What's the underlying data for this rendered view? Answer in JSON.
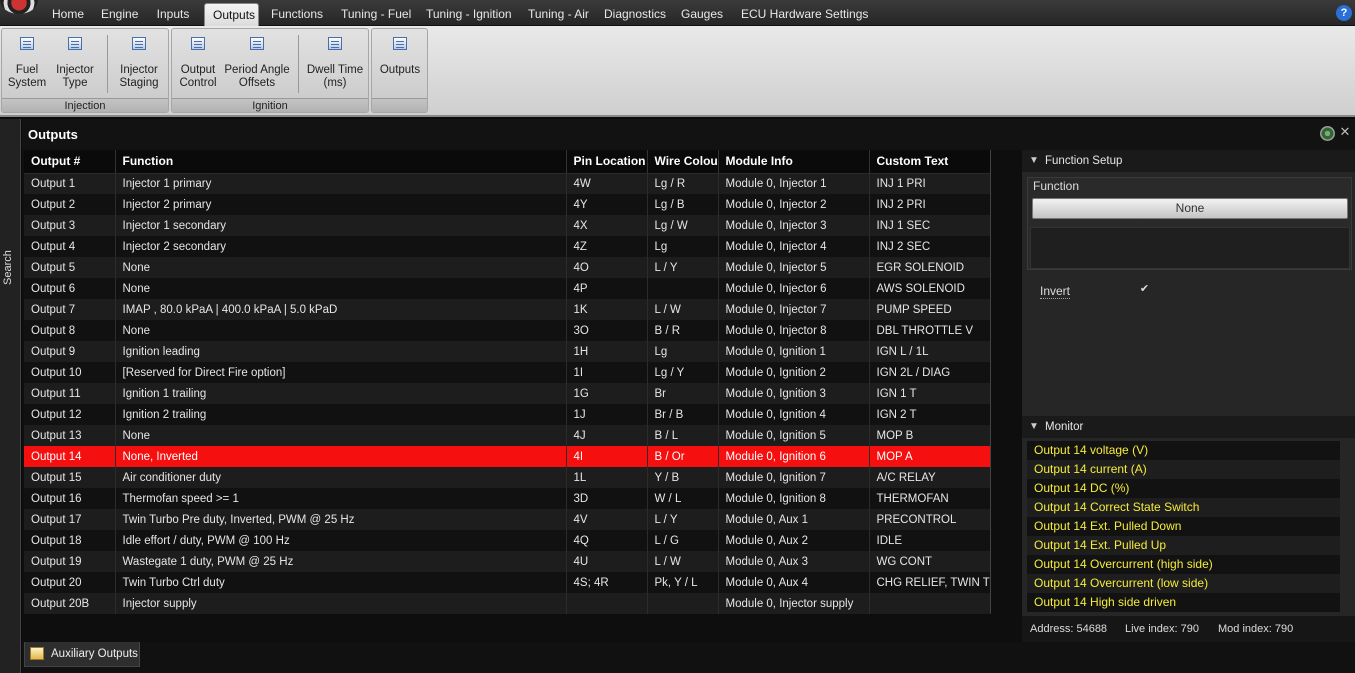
{
  "menu": {
    "tabs": [
      "Home",
      "Engine",
      "Inputs",
      "Outputs",
      "Functions",
      "Tuning - Fuel",
      "Tuning - Ignition",
      "Tuning - Air",
      "Diagnostics",
      "Gauges",
      "ECU Hardware Settings"
    ],
    "active": "Outputs",
    "help": "?"
  },
  "ribbon": {
    "groups": [
      {
        "label": "Injection",
        "buttons": [
          [
            "Fuel",
            "System"
          ],
          [
            "Injector",
            "Type"
          ],
          [
            "Injector",
            "Staging"
          ]
        ]
      },
      {
        "label": "Ignition",
        "buttons": [
          [
            "Output",
            "Control"
          ],
          [
            "Period Angle",
            "Offsets"
          ],
          [
            "Dwell Time",
            "(ms)"
          ]
        ]
      },
      {
        "label": "",
        "buttons": [
          [
            "Outputs"
          ]
        ]
      }
    ]
  },
  "sidebar": {
    "search_label": "Search"
  },
  "panel": {
    "title": "Outputs"
  },
  "table": {
    "headers": [
      "Output #",
      "Function",
      "Pin Location",
      "Wire Colour",
      "Module Info",
      "Custom Text"
    ],
    "selected_index": 13,
    "rows": [
      [
        "Output 1",
        "Injector 1 primary",
        "4W",
        "Lg / R",
        "Module 0, Injector 1",
        "INJ 1 PRI"
      ],
      [
        "Output 2",
        "Injector 2 primary",
        "4Y",
        "Lg / B",
        "Module 0, Injector 2",
        "INJ 2 PRI"
      ],
      [
        "Output 3",
        "Injector 1 secondary",
        "4X",
        "Lg / W",
        "Module 0, Injector 3",
        "INJ 1 SEC"
      ],
      [
        "Output 4",
        "Injector 2 secondary",
        "4Z",
        "Lg",
        "Module 0, Injector 4",
        "INJ 2 SEC"
      ],
      [
        "Output 5",
        "None",
        "4O",
        "L / Y",
        "Module 0, Injector 5",
        "EGR SOLENOID"
      ],
      [
        "Output 6",
        "None",
        "4P",
        "",
        "Module 0, Injector 6",
        "AWS SOLENOID"
      ],
      [
        "Output 7",
        "IMAP , 80.0 kPaA | 400.0 kPaA | 5.0 kPaD",
        "1K",
        "L / W",
        "Module 0, Injector 7",
        "PUMP SPEED"
      ],
      [
        "Output 8",
        "None",
        "3O",
        "B / R",
        "Module 0, Injector 8",
        "DBL THROTTLE V"
      ],
      [
        "Output 9",
        "Ignition leading",
        "1H",
        "Lg",
        "Module 0, Ignition 1",
        "IGN L / 1L"
      ],
      [
        "Output 10",
        "[Reserved for Direct Fire option]",
        "1I",
        "Lg / Y",
        "Module 0, Ignition 2",
        "IGN 2L / DIAG"
      ],
      [
        "Output 11",
        "Ignition 1 trailing",
        "1G",
        "Br",
        "Module 0, Ignition 3",
        "IGN 1 T"
      ],
      [
        "Output 12",
        "Ignition 2 trailing",
        "1J",
        "Br / B",
        "Module 0, Ignition 4",
        "IGN 2 T"
      ],
      [
        "Output 13",
        "None",
        "4J",
        "B / L",
        "Module 0, Ignition 5",
        "MOP B"
      ],
      [
        "Output 14",
        "None, Inverted",
        "4I",
        "B / Or",
        "Module 0, Ignition 6",
        "MOP A"
      ],
      [
        "Output 15",
        "Air conditioner duty",
        "1L",
        "Y / B",
        "Module 0, Ignition 7",
        "A/C RELAY"
      ],
      [
        "Output 16",
        "Thermofan speed >= 1",
        "3D",
        "W / L",
        "Module 0, Ignition 8",
        "THERMOFAN"
      ],
      [
        "Output 17",
        "Twin Turbo Pre duty, Inverted, PWM @ 25 Hz",
        "4V",
        "L / Y",
        "Module 0, Aux 1",
        "PRECONTROL"
      ],
      [
        "Output 18",
        "Idle effort / duty, PWM @ 100 Hz",
        "4Q",
        "L / G",
        "Module 0, Aux 2",
        "IDLE"
      ],
      [
        "Output 19",
        "Wastegate 1 duty, PWM @ 25 Hz",
        "4U",
        "L / W",
        "Module 0, Aux 3",
        "WG CONT"
      ],
      [
        "Output 20",
        "Twin Turbo Ctrl duty",
        "4S; 4R",
        "Pk, Y / L",
        "Module 0, Aux 4",
        "CHG RELIEF, TWIN TUR"
      ],
      [
        "Output 20B",
        "Injector supply",
        "",
        "",
        "Module 0, Injector supply",
        ""
      ]
    ]
  },
  "function_setup": {
    "header": "Function Setup",
    "function_label": "Function",
    "function_value": "None",
    "invert_label": "Invert",
    "invert_checked": true,
    "check_glyph": "✔"
  },
  "monitor": {
    "header": "Monitor",
    "items": [
      "Output 14 voltage (V)",
      "Output 14 current (A)",
      "Output 14  DC (%)",
      "Output 14 Correct State Switch",
      "Output 14 Ext. Pulled Down",
      "Output 14 Ext. Pulled Up",
      "Output 14  Overcurrent (high side)",
      "Output 14  Overcurrent (low side)",
      "Output 14  High side driven"
    ]
  },
  "status": {
    "address": "Address: 54688",
    "live_index": "Live index: 790",
    "mod_index": "Mod index: 790"
  },
  "bottom_tabs": {
    "aux_outputs": "Auxiliary Outputs"
  },
  "colors": {
    "selected_row": "#f50f0f",
    "monitor_text": "#f5ec3b",
    "background": "#0c0c0c"
  }
}
